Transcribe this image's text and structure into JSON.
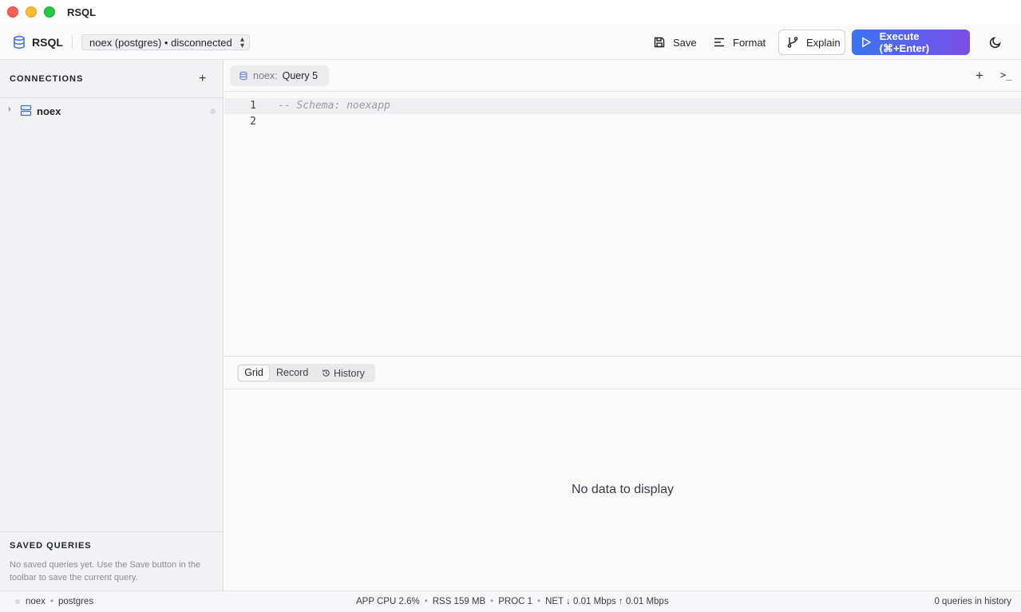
{
  "window": {
    "title": "RSQL"
  },
  "toolbar": {
    "brand": "RSQL",
    "connection_select": "noex (postgres) • disconnected",
    "save_label": "Save",
    "format_label": "Format",
    "explain_label": "Explain",
    "execute_label": "Execute (⌘+Enter)",
    "accent_gradient": [
      "#3a74f5",
      "#7b4ee8"
    ]
  },
  "sidebar": {
    "connections_title": "CONNECTIONS",
    "connections": [
      {
        "name": "noex",
        "status": "disconnected"
      }
    ],
    "saved_title": "SAVED QUERIES",
    "saved_empty": "No saved queries yet. Use the Save button in the toolbar to save the current query."
  },
  "tabs": [
    {
      "connection": "noex:",
      "name": "Query 5",
      "active": true
    }
  ],
  "editor": {
    "lines": [
      {
        "number": "1",
        "text": "-- Schema: noexapp"
      },
      {
        "number": "2",
        "text": ""
      }
    ]
  },
  "results": {
    "tabs": [
      "Grid",
      "Record",
      "History"
    ],
    "active_tab": "Grid",
    "empty": "No data to display"
  },
  "status": {
    "connection": "noex",
    "driver": "postgres",
    "cpu": "APP CPU 2.6%",
    "rss": "RSS 159 MB",
    "proc": "PROC 1",
    "net": "NET ↓ 0.01 Mbps ↑ 0.01 Mbps",
    "history": "0 queries in history"
  }
}
